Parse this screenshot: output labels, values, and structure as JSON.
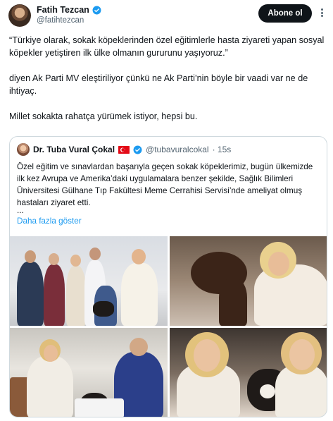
{
  "tweet": {
    "author_name": "Fatih Tezcan",
    "author_handle": "@fatihtezcan",
    "follow_label": "Abone ol",
    "paragraphs": [
      "“Türkiye olarak, sokak köpeklerinden özel eğitimlerle hasta ziyareti yapan sosyal köpekler yetiştiren ilk ülke olmanın gururunu yaşıyoruz.”",
      "diyen Ak Parti MV eleştiriliyor çünkü ne Ak Parti’nin böyle bir vaadi var ne de ihtiyaç.",
      "Millet sokakta rahatça yürümek istiyor, hepsi bu."
    ]
  },
  "quote": {
    "author_name": "Dr. Tuba Vural Çokal",
    "author_handle": "@tubavuralcokal",
    "time": "· 15s",
    "text": "Özel eğitim ve sınavlardan başarıyla geçen sokak köpeklerimiz, bugün ülkemizde ilk kez Avrupa ve Amerika’daki uygulamalara benzer şekilde, Sağlık Bilimleri Üniversitesi Gülhane Tıp Fakültesi Meme Cerrahisi Servisi’nde ameliyat olmuş hastaları ziyaret etti.",
    "ellipsis": "...",
    "show_more": "Daha fazla göster"
  },
  "colors": {
    "verified": "#1d9bf0",
    "link": "#1d9bf0",
    "button_bg": "#0f1419",
    "flag": "#e30a17"
  },
  "icons": [
    "verified-badge-icon",
    "more-options-icon",
    "turkey-flag-icon"
  ]
}
